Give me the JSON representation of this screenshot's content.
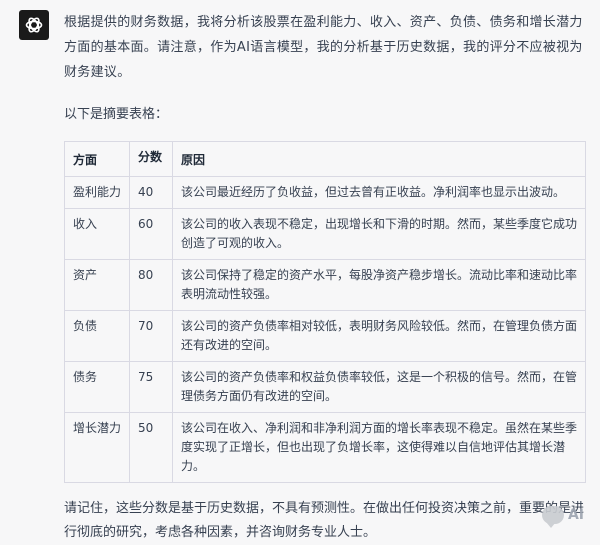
{
  "message": {
    "avatar_icon": "openai-logo-icon",
    "intro": "根据提供的财务数据，我将分析该股票在盈利能力、收入、资产、负债、债务和增长潜力方面的基本面。请注意，作为AI语言模型，我的分析基于历史数据，我的评分不应被视为财务建议。",
    "subhead": "以下是摘要表格：",
    "table": {
      "headers": [
        "方面",
        "分数",
        "原因"
      ],
      "rows": [
        {
          "aspect": "盈利能力",
          "score": "40",
          "reason": "该公司最近经历了负收益，但过去曾有正收益。净利润率也显示出波动。"
        },
        {
          "aspect": "收入",
          "score": "60",
          "reason": "该公司的收入表现不稳定，出现增长和下滑的时期。然而，某些季度它成功创造了可观的收入。"
        },
        {
          "aspect": "资产",
          "score": "80",
          "reason": "该公司保持了稳定的资产水平，每股净资产稳步增长。流动比率和速动比率表明流动性较强。"
        },
        {
          "aspect": "负债",
          "score": "70",
          "reason": "该公司的资产负债率相对较低，表明财务风险较低。然而，在管理负债方面还有改进的空间。"
        },
        {
          "aspect": "债务",
          "score": "75",
          "reason": "该公司的资产负债率和权益负债率较低，这是一个积极的信号。然而，在管理债务方面仍有改进的空间。"
        },
        {
          "aspect": "增长潜力",
          "score": "50",
          "reason": "该公司在收入、净利润和非净利润方面的增长率表现不稳定。虽然在某些季度实现了正增长，但也出现了负增长率，这使得难以自信地评估其增长潜力。"
        }
      ]
    },
    "footer": "请记住，这些分数是基于历史数据，不具有预测性。在做出任何投资决策之前，重要的是进行彻底的研究，考虑各种因素，并咨询财务专业人士。"
  },
  "watermark": {
    "icon": "chat-bubble-icon",
    "text": "AI"
  }
}
